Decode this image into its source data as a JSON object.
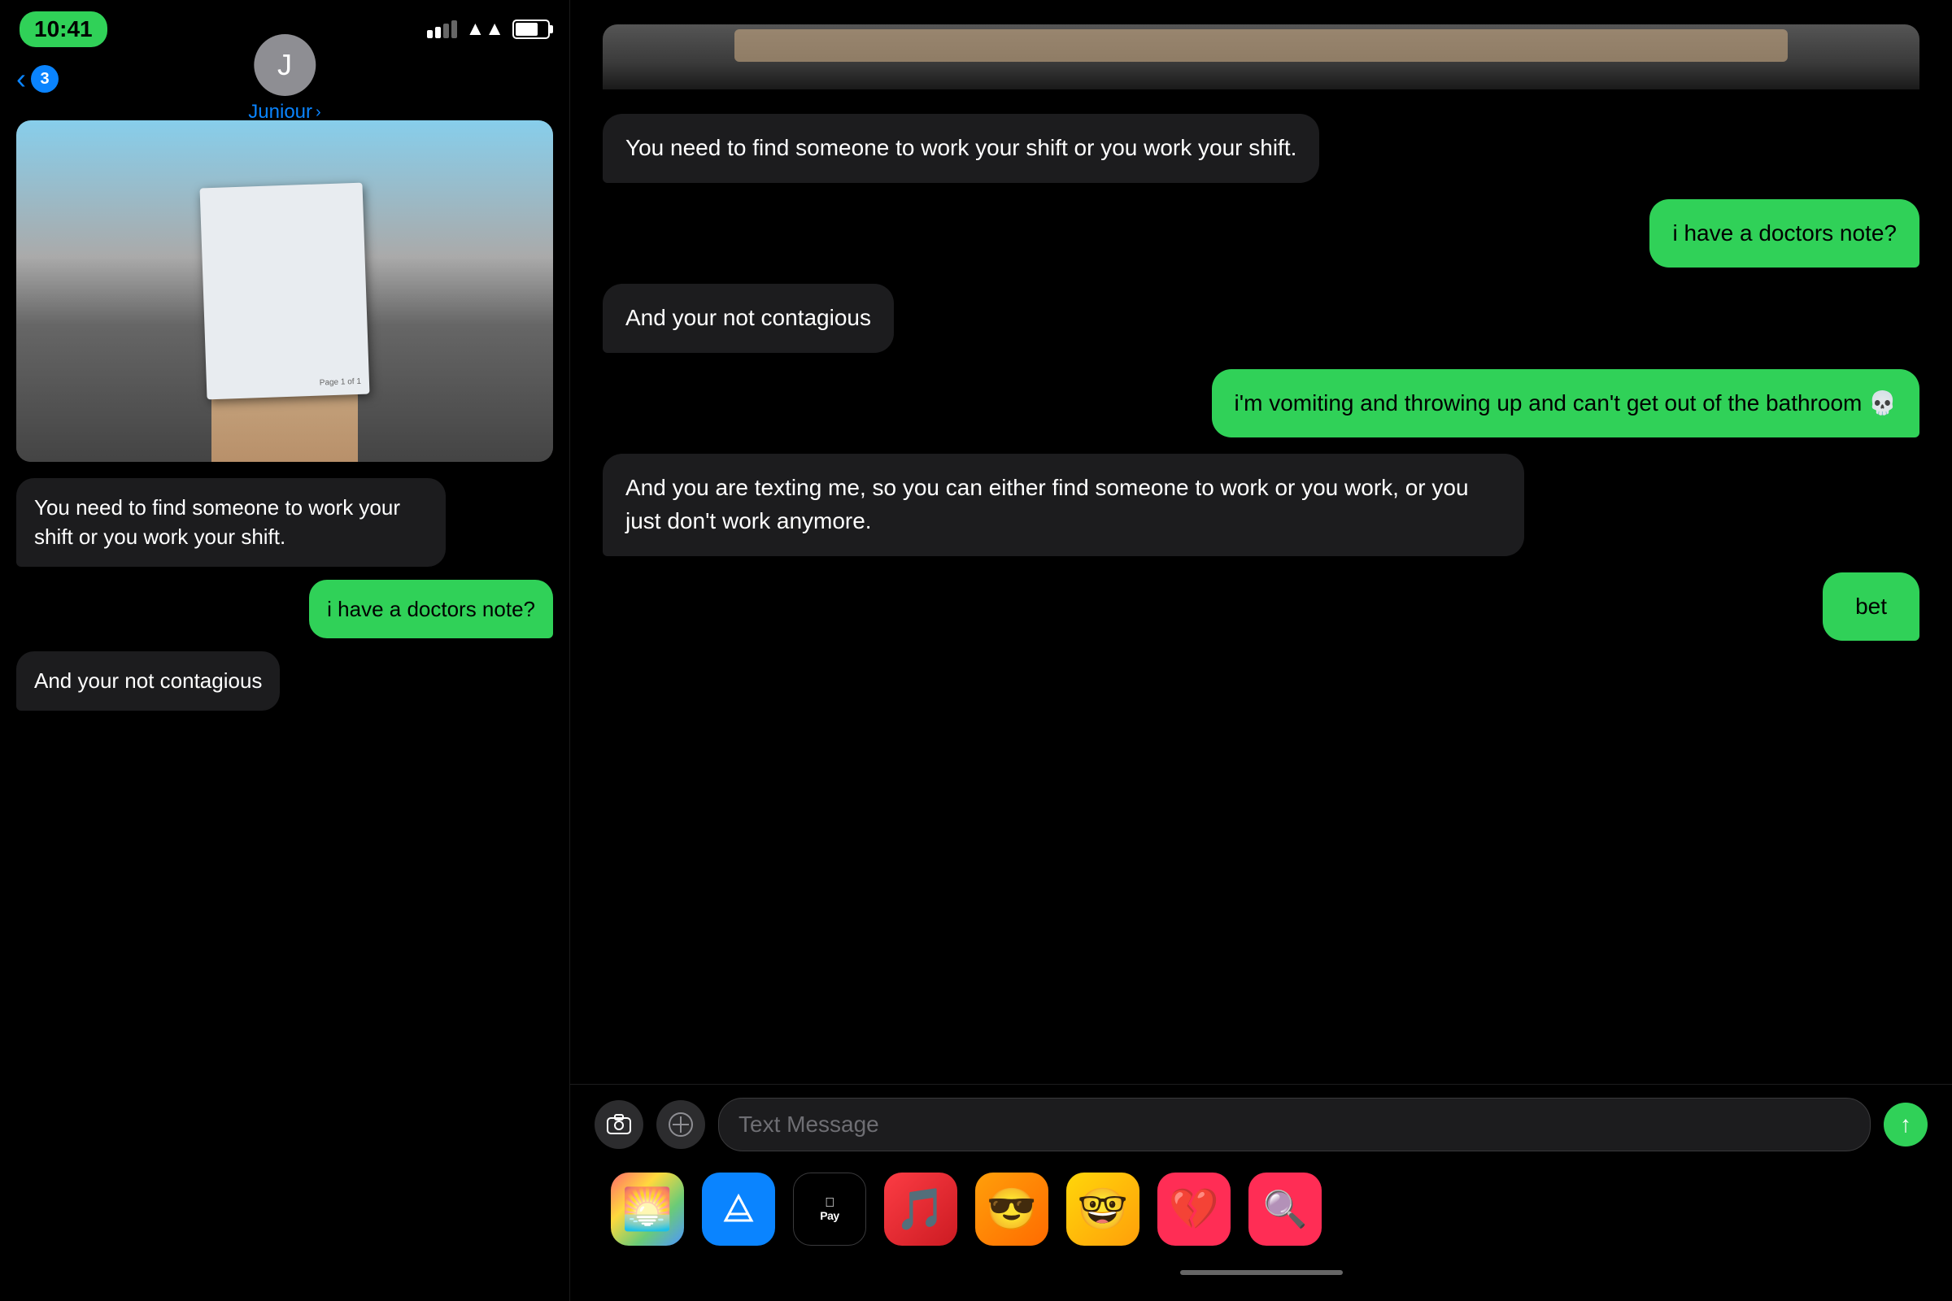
{
  "left": {
    "statusBar": {
      "time": "10:41",
      "backCount": "3"
    },
    "contact": {
      "initial": "J",
      "name": "Juniour",
      "chevron": "›"
    },
    "photo": {
      "paperText": "Page 1 of 1"
    },
    "messages": [
      {
        "type": "received",
        "text": "You need to find someone to work your shift or you work your shift."
      },
      {
        "type": "sent",
        "text": "i have a doctors note?"
      },
      {
        "type": "received",
        "text": "And your not contagious"
      }
    ]
  },
  "right": {
    "messages": [
      {
        "type": "received",
        "text": "You need to find someone to work your shift or you work your shift."
      },
      {
        "type": "sent",
        "text": "i have a doctors note?"
      },
      {
        "type": "received",
        "text": "And your not contagious"
      },
      {
        "type": "sent",
        "text": "i'm vomiting and throwing up and can't get out of the bathroom 💀"
      },
      {
        "type": "received",
        "text": "And you are texting me, so you can either find someone to work or you work, or you just don't work anymore."
      },
      {
        "type": "sent",
        "text": "bet"
      }
    ],
    "inputBar": {
      "placeholder": "Text Message",
      "cameraIcon": "⊙",
      "appIcon": "⊕"
    },
    "apps": [
      {
        "name": "Photos",
        "icon": "🌅",
        "class": "app-photos"
      },
      {
        "name": "App Store",
        "icon": "🅐",
        "class": "app-appstore"
      },
      {
        "name": "Apple Pay",
        "icon": "Apple Pay",
        "class": "app-appay"
      },
      {
        "name": "Music",
        "icon": "♪",
        "class": "app-music"
      },
      {
        "name": "Memoji1",
        "icon": "😎",
        "class": "app-memoji1"
      },
      {
        "name": "Memoji2",
        "icon": "🤓",
        "class": "app-memoji2"
      },
      {
        "name": "Heartbreak",
        "icon": "💔",
        "class": "app-heartbreak"
      },
      {
        "name": "Globe",
        "icon": "🔍",
        "class": "app-globe"
      }
    ]
  },
  "icons": {
    "back_chevron": "‹",
    "send_arrow": "↑"
  }
}
